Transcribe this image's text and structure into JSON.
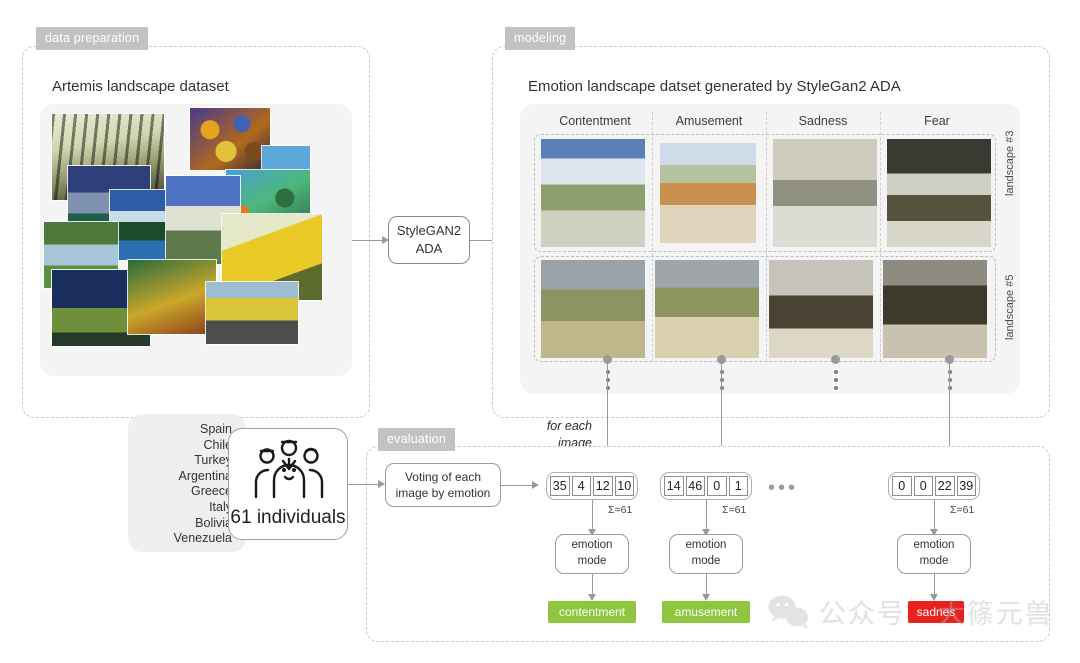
{
  "sections": {
    "data_preparation": "data preparation",
    "modeling": "modeling",
    "evaluation": "evaluation"
  },
  "data_prep": {
    "title": "Artemis landscape dataset"
  },
  "model": {
    "box_line1": "StyleGAN2",
    "box_line2": "ADA",
    "title": "Emotion landscape datset generated by StyleGan2 ADA",
    "columns": [
      "Contentment",
      "Amusement",
      "Sadness",
      "Fear"
    ],
    "rows": [
      "landscape #3",
      "landscape #5"
    ]
  },
  "evaluation": {
    "countries": [
      "Spain",
      "Chile",
      "Turkey",
      "Argentina",
      "Greece",
      "Italy",
      "Bolivia",
      "Venezuela"
    ],
    "participants_label": "61 individuals",
    "voting_box_line1": "Voting of each",
    "voting_box_line2": "image by emotion",
    "for_each_line1": "for each",
    "for_each_line2": "image",
    "ellipsis": "•••",
    "sum_label": "Σ=61",
    "mode_box_line1": "emotion",
    "mode_box_line2": "mode",
    "votes": [
      {
        "values": [
          35,
          4,
          12,
          10
        ],
        "sum": "Σ=61",
        "result": "contentment",
        "result_color": "#8fc63f"
      },
      {
        "values": [
          14,
          46,
          0,
          1
        ],
        "sum": "Σ=61",
        "result": "amusement",
        "result_color": "#8fc63f"
      },
      {
        "values": [
          0,
          0,
          22,
          39
        ],
        "sum": "Σ=61",
        "result": "sadnes",
        "result_color": "#e8231f"
      }
    ]
  },
  "watermark": {
    "text": "公众号 · 大篠元兽",
    "icon": "wechat-icon"
  },
  "colors": {
    "tag_bg": "#c2c2c2",
    "panel_bg": "#f4f4f4",
    "line": "#9a9a9a",
    "green": "#8fc63f",
    "red": "#e8231f"
  }
}
